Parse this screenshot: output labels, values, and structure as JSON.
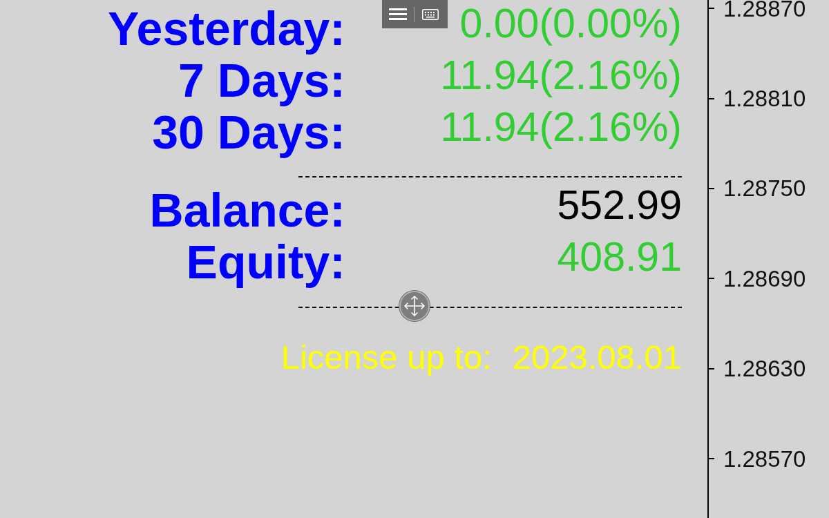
{
  "stats": [
    {
      "label": "Yesterday:",
      "value": "0.00(0.00%)",
      "color": "#32cd32"
    },
    {
      "label": "7 Days:",
      "value": "11.94(2.16%)",
      "color": "#32cd32"
    },
    {
      "label": "30 Days:",
      "value": "11.94(2.16%)",
      "color": "#32cd32"
    }
  ],
  "account": [
    {
      "label": "Balance:",
      "value": "552.99",
      "color": "#000000"
    },
    {
      "label": "Equity:",
      "value": "408.91",
      "color": "#32cd32"
    }
  ],
  "license": {
    "label": "License up to:",
    "value": "2023.08.01"
  },
  "price_axis": {
    "labels": [
      "1.28870",
      "1.28810",
      "1.28750",
      "1.28690",
      "1.28630",
      "1.28570"
    ]
  }
}
